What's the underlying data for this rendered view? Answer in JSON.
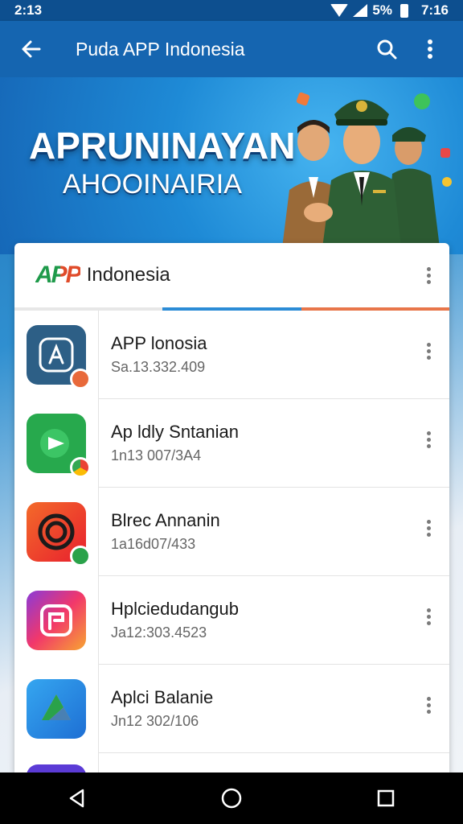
{
  "status_bar": {
    "time_left": "2:13",
    "battery": "5%",
    "time_right": "7:16"
  },
  "app_bar": {
    "title": "Puda APP Indonesia",
    "back_icon": "arrow-left-icon",
    "search_icon": "search-icon",
    "menu_icon": "more-vert-icon"
  },
  "banner": {
    "title": "APRUNINAYAN",
    "subtitle": "AHOOINAIRIA"
  },
  "card": {
    "logo": "APP",
    "header_title": "Indonesia",
    "items": [
      {
        "name": "APP lonosia",
        "sub": "Sa.13.332.409",
        "icon_color": "#2d5f86",
        "badge_color": "#e8693a"
      },
      {
        "name": "Ap ldly Sntanian",
        "sub": "1n13 007/3A4",
        "icon_color": "#27a94d",
        "badge_color": "#f4b400"
      },
      {
        "name": "Blrec Annanin",
        "sub": "1a16d07/433",
        "icon_color": "#ef4a24",
        "badge_color": "#2aa24a"
      },
      {
        "name": "Hplciedudangub",
        "sub": "Ja12:303.4523",
        "icon_color": "#f24d6a",
        "badge_color": ""
      },
      {
        "name": "Aplci Balanie",
        "sub": "Jn12 302/106",
        "icon_color": "#2b8fe0",
        "badge_color": ""
      }
    ]
  },
  "colors": {
    "appbar": "#1565b0",
    "statusbar": "#0d4f8f",
    "accent_blue": "#2c8cd6",
    "accent_orange": "#e8764a"
  }
}
